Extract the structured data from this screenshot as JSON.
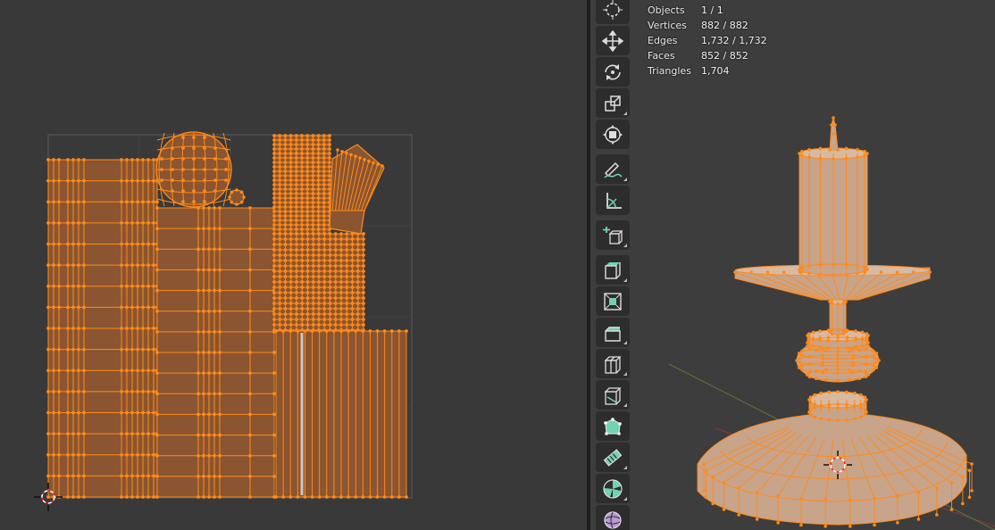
{
  "stats": {
    "rows": [
      {
        "label": "Objects",
        "value": "1 / 1"
      },
      {
        "label": "Vertices",
        "value": "882 / 882"
      },
      {
        "label": "Edges",
        "value": "1,732 / 1,732"
      },
      {
        "label": "Faces",
        "value": "852 / 852"
      },
      {
        "label": "Triangles",
        "value": "1,704"
      }
    ]
  },
  "toolbar": {
    "tools": [
      {
        "name": "cursor-tool",
        "icon": "cursor-icon"
      },
      {
        "name": "move-tool",
        "icon": "move-icon"
      },
      {
        "name": "rotate-tool",
        "icon": "rotate-icon"
      },
      {
        "name": "scale-tool",
        "icon": "scale-icon"
      },
      {
        "name": "transform-tool",
        "icon": "transform-icon"
      },
      {
        "name": "annotate-tool",
        "icon": "annotate-icon"
      },
      {
        "name": "measure-tool",
        "icon": "measure-icon"
      },
      {
        "name": "add-cube-tool",
        "icon": "add-cube-icon"
      },
      {
        "name": "extrude-tool",
        "icon": "extrude-icon"
      },
      {
        "name": "inset-tool",
        "icon": "inset-icon"
      },
      {
        "name": "bevel-tool",
        "icon": "bevel-icon"
      },
      {
        "name": "loop-cut-tool",
        "icon": "loop-cut-icon"
      },
      {
        "name": "knife-tool",
        "icon": "knife-icon"
      },
      {
        "name": "poly-build-tool",
        "icon": "poly-build-icon"
      },
      {
        "name": "spin-tool",
        "icon": "spin-icon"
      },
      {
        "name": "smooth-tool",
        "icon": "smooth-icon"
      },
      {
        "name": "shrink-tool",
        "icon": "shrink-icon"
      }
    ]
  },
  "colors": {
    "selection": "#ff8a1a",
    "uv_fill": "#8a5530",
    "mesh_fill": "#c8a48a",
    "background": "#393939"
  }
}
